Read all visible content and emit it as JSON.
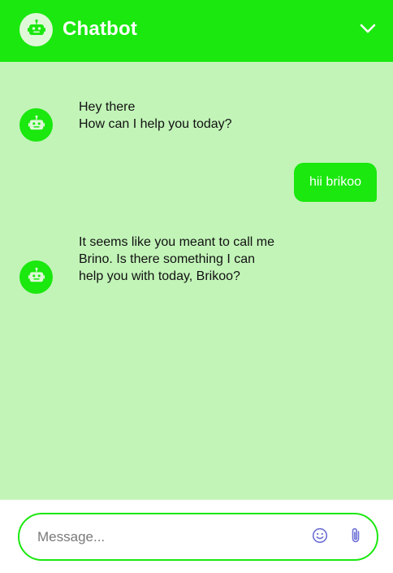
{
  "header": {
    "title": "Chatbot",
    "avatar_icon": "robot-icon",
    "collapse_icon": "chevron-down-icon"
  },
  "messages": [
    {
      "sender": "bot",
      "text": "Hey there\nHow can I help you today?"
    },
    {
      "sender": "user",
      "text": "hii brikoo"
    },
    {
      "sender": "bot",
      "text": "It seems like you meant to call me\nBrino. Is there something I can\nhelp you with today, Brikoo?"
    }
  ],
  "composer": {
    "placeholder": "Message...",
    "emoji_icon": "smiley-icon",
    "attach_icon": "paperclip-icon"
  },
  "colors": {
    "brand_green": "#1ae80e",
    "chat_background": "#c2f4b8",
    "header_avatar_bg": "#dff8d8",
    "icon_purple": "#6b6fd6"
  }
}
